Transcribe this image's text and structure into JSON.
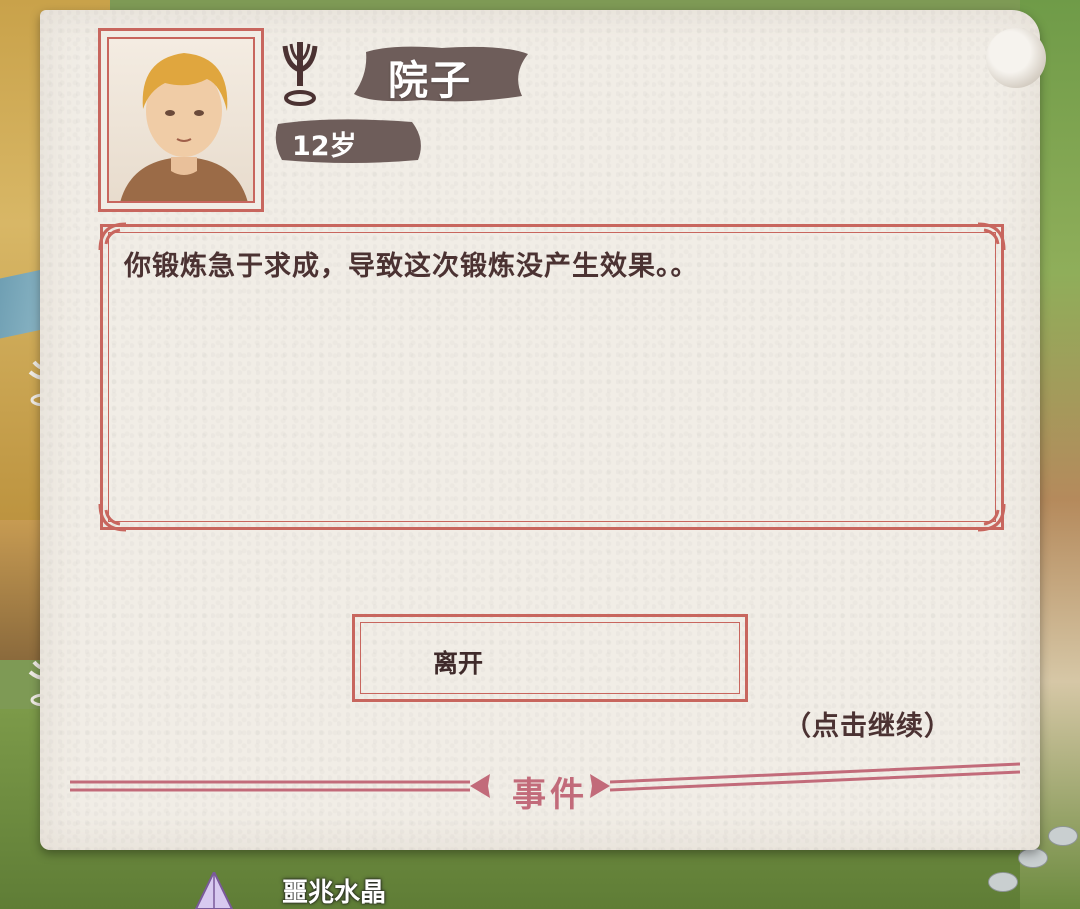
{
  "location": {
    "name": "院子"
  },
  "character": {
    "age": "12岁",
    "portrait": "blond-young-man-portrait"
  },
  "event": {
    "message": "你锻炼急于求成，导致这次锻炼没产生效果。。",
    "options": [
      {
        "label": "离开"
      }
    ],
    "continue_hint": "（点击继续）",
    "footer_title": "事件"
  },
  "map": {
    "bottom_item_label": "噩兆水晶"
  },
  "colors": {
    "accent": "#c8665e",
    "footer_accent": "#c26b7a",
    "text": "#4b3232",
    "paper": "#f1ede6"
  },
  "icons": [
    "location-emblem-icon",
    "crystal-icon",
    "map-marker-icon",
    "ornament-corner-icon"
  ]
}
